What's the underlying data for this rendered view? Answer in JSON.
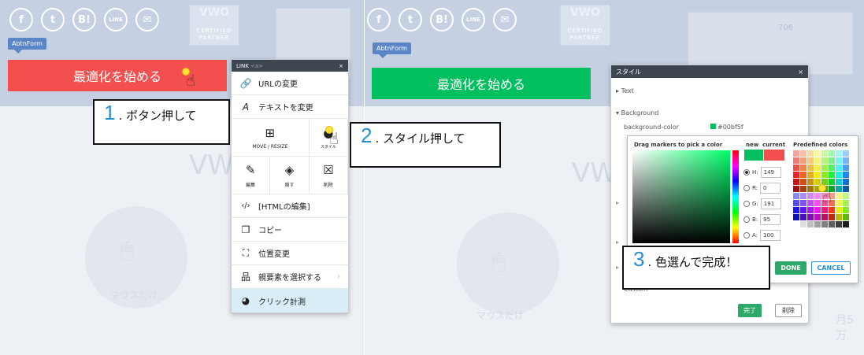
{
  "form_tag": "AbtnForm",
  "certified": {
    "logo": "VWO",
    "line1": "CERTIFIED",
    "line2": "PARTNER"
  },
  "social": [
    {
      "name": "facebook-icon",
      "glyph": "f"
    },
    {
      "name": "twitter-icon",
      "glyph": "t"
    },
    {
      "name": "hatena-bookmark-icon",
      "glyph": "B!"
    },
    {
      "name": "line-icon",
      "glyph": "LINE"
    },
    {
      "name": "mail-icon",
      "glyph": "✉"
    }
  ],
  "cta_label": "最適化を始める",
  "background": {
    "vwo_text": "VWO",
    "mouse_label": "マウスだけ",
    "right_number": "706",
    "right_partial_text": "月5万"
  },
  "steps": {
    "step1": {
      "number": "1",
      "label": ". ボタン押して"
    },
    "step2": {
      "number": "2",
      "label": ". スタイル押して"
    },
    "step3": {
      "number": "3",
      "label": ". 色選んで完成！"
    }
  },
  "context_menu": {
    "title": "LINK",
    "tag": "<a>",
    "close": "×",
    "change_url": "URLの変更",
    "change_text": "テキストを変更",
    "move_resize": "MOVE / RESIZE",
    "style": "スタイル",
    "edit": "編集",
    "hide": "隠す",
    "delete": "削除",
    "edit_html": "[HTMLの編集]",
    "copy": "コピー",
    "reposition": "位置変更",
    "select_parent": "親要素を選択する",
    "click_tracking": "クリック計測"
  },
  "style_panel": {
    "title": "スタイル",
    "close": "×",
    "text_section": "Text",
    "background_section": "Background",
    "bg_color_label": "background-color",
    "bg_color_value": "#00bf5f",
    "custom_label": "Custom",
    "done_button": "完了",
    "delete_button": "削除"
  },
  "color_picker": {
    "drag_label": "Drag markers to pick a color",
    "new_label": "new",
    "current_label": "current",
    "predefined_label": "Predefined colors",
    "fields": [
      {
        "key": "H:",
        "value": "149",
        "selected": true
      },
      {
        "key": "R:",
        "value": "0",
        "selected": false
      },
      {
        "key": "G:",
        "value": "191",
        "selected": false
      },
      {
        "key": "B:",
        "value": "95",
        "selected": false
      },
      {
        "key": "A:",
        "value": "100",
        "selected": false
      }
    ],
    "hex_partial": "5f",
    "done": "DONE",
    "cancel": "CANCEL"
  },
  "colors": {
    "cta_red": "#f44f4f",
    "cta_green": "#00bf5f",
    "accent_blue": "#2a8fd0",
    "current_red": "#f44f4f",
    "new_green": "#00bf5f"
  }
}
